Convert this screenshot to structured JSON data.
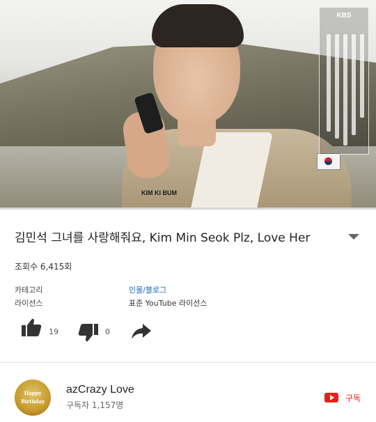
{
  "video": {
    "progress_fraction": 0.0,
    "overlay_logo": "KBS",
    "name_tag": "KIM KI BUM"
  },
  "info": {
    "title": "김민석 그녀를 사랑해줘요, Kim Min Seok  Plz, Love Her",
    "views": "조회수 6,415회",
    "category_label": "카테고리",
    "category_value": "인물/블로그",
    "license_label": "라이선스",
    "license_value": "표준 YouTube 라이선스"
  },
  "actions": {
    "like_count": "19",
    "dislike_count": "0",
    "icons": [
      "thumbs-up-icon",
      "thumbs-down-icon",
      "share-icon",
      "expand-chevron-icon"
    ]
  },
  "channel": {
    "name": "azCrazy Love",
    "subscribers": "구독자 1,157명",
    "avatar_text_1": "Happy",
    "avatar_text_2": "Birthday",
    "subscribe_label": "구독"
  },
  "colors": {
    "accent": "#e62117",
    "link": "#1a66c9"
  }
}
